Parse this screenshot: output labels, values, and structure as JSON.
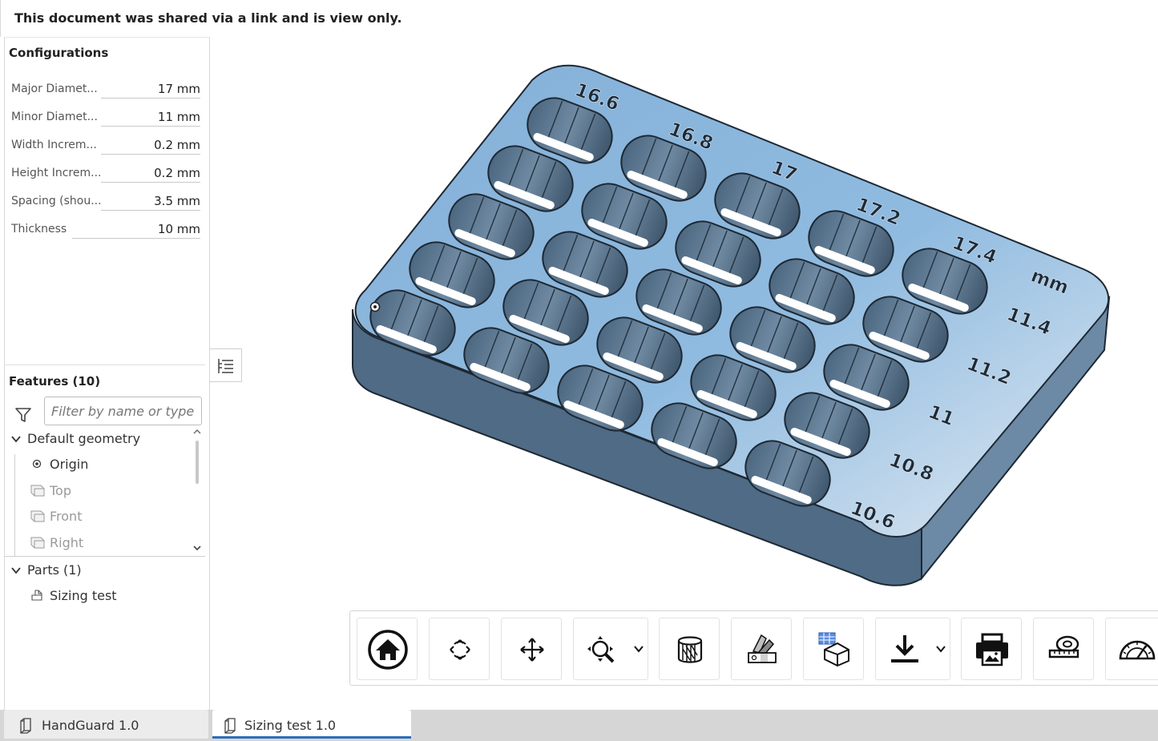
{
  "banner": {
    "text": "This document was shared via a link and is view only."
  },
  "configurations": {
    "title": "Configurations",
    "rows": [
      {
        "label": "Major Diamet...",
        "value": "17 mm"
      },
      {
        "label": "Minor Diamet...",
        "value": "11 mm"
      },
      {
        "label": "Width Increm...",
        "value": "0.2 mm"
      },
      {
        "label": "Height Increm...",
        "value": "0.2 mm"
      },
      {
        "label": "Spacing (shou...",
        "value": "3.5 mm"
      },
      {
        "label": "Thickness",
        "value": "10 mm"
      }
    ]
  },
  "features": {
    "title": "Features (10)",
    "filter_placeholder": "Filter by name or type",
    "default_geometry": "Default geometry",
    "items": [
      "Origin",
      "Top",
      "Front",
      "Right"
    ],
    "parts_title": "Parts (1)",
    "part": "Sizing test"
  },
  "model": {
    "top_labels": [
      "16.6",
      "16.8",
      "17",
      "17.2",
      "17.4",
      "mm"
    ],
    "side_labels": [
      "11.4",
      "11.2",
      "11",
      "10.8",
      "10.6"
    ],
    "colors": {
      "top": "#8eb8de",
      "side": "#4f6b85",
      "edge": "#1d2833"
    }
  },
  "toolbar": {
    "icons": [
      "home-icon",
      "rotate-icon",
      "pan-icon",
      "zoom-icon",
      "section-view-icon",
      "appearance-icon",
      "display-states-icon",
      "export-icon",
      "print-icon",
      "measure-tape-icon",
      "protractor-icon"
    ]
  },
  "tabs": [
    {
      "label": "HandGuard 1.0",
      "active": false
    },
    {
      "label": "Sizing test 1.0",
      "active": true
    }
  ]
}
